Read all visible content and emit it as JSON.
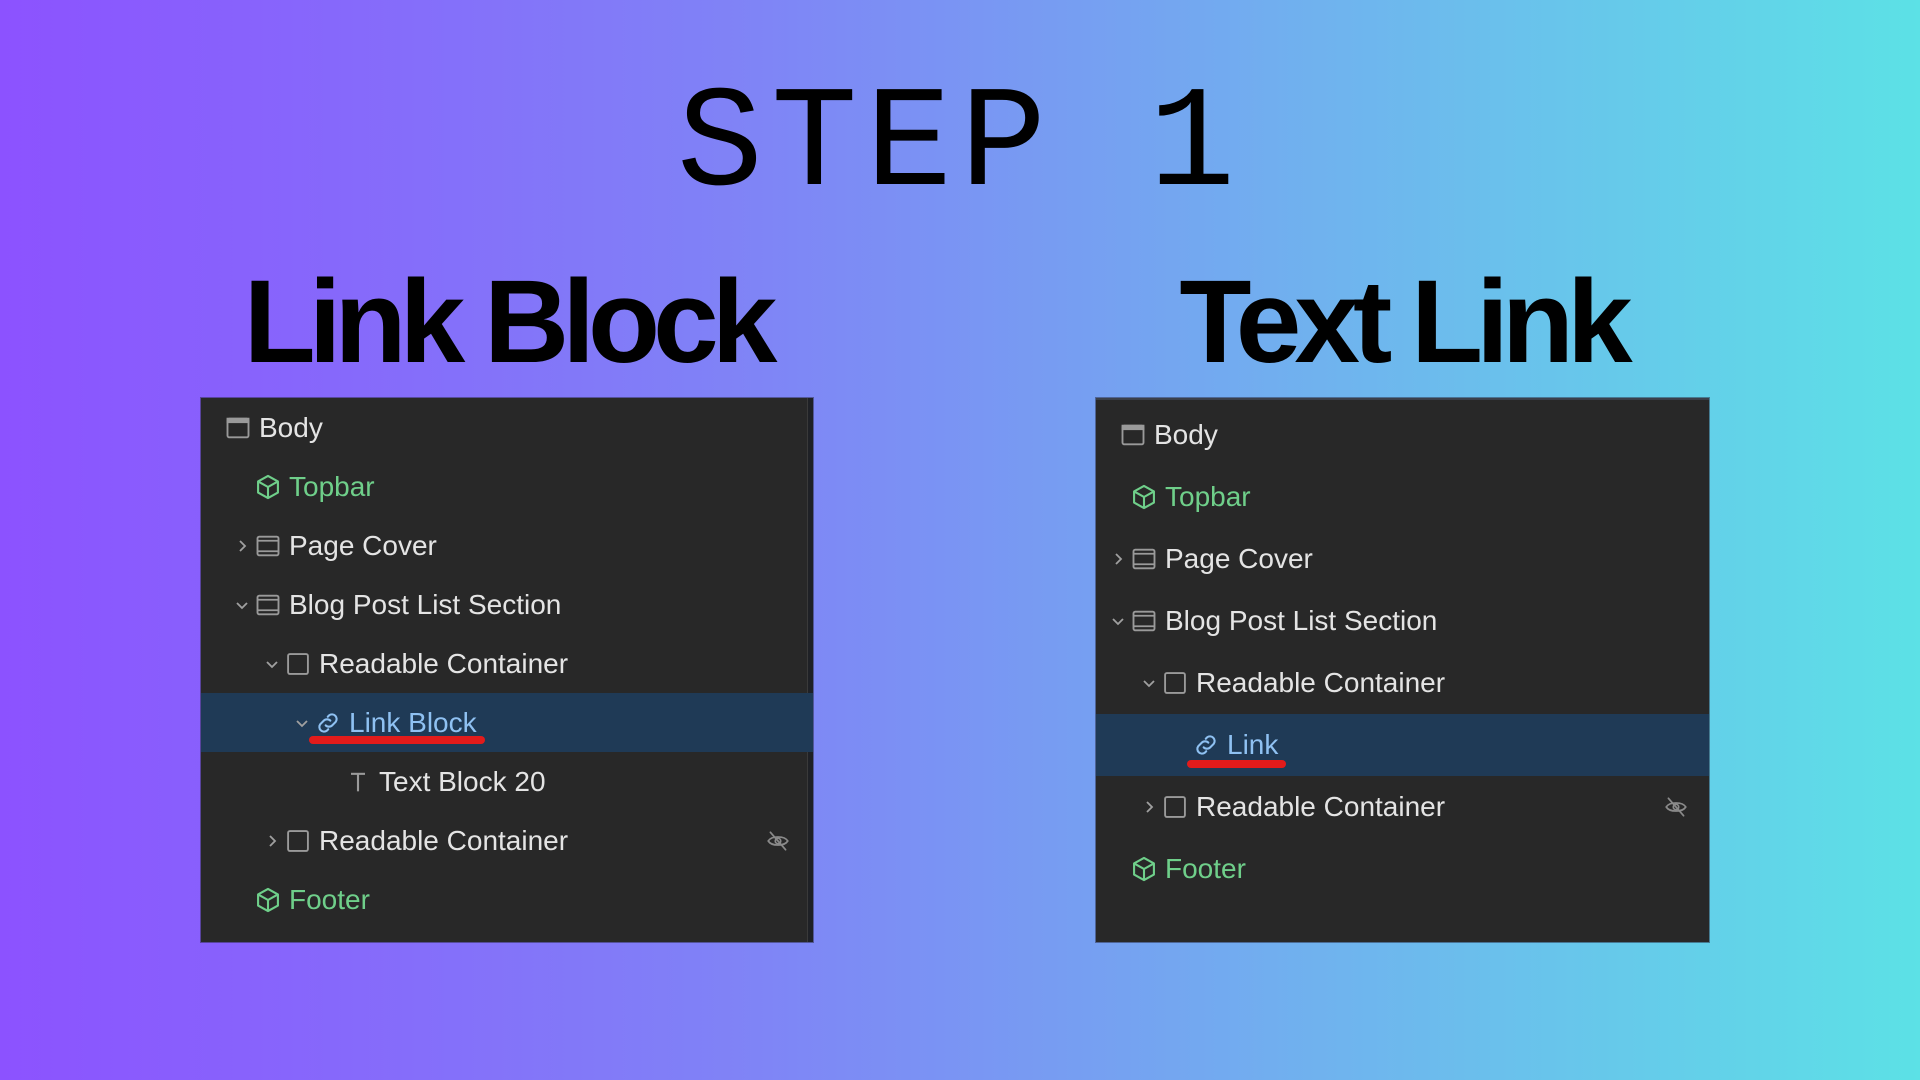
{
  "title": "STEP 1",
  "columns": {
    "left": {
      "heading": "Link Block"
    },
    "right": {
      "heading": "Text Link"
    }
  },
  "colors": {
    "gradient_start": "#8c52ff",
    "gradient_end": "#5ce1e6",
    "panel_bg": "#282828",
    "selected_row": "#1f3a56",
    "component_text": "#6fcf8a",
    "selected_text": "#8fc1f2",
    "underline": "#e21b1b"
  },
  "left_tree": [
    {
      "label": "Body",
      "icon": "body-icon",
      "level": 0,
      "chevron": "none"
    },
    {
      "label": "Topbar",
      "icon": "component-icon",
      "level": 1,
      "chevron": "none",
      "component": true
    },
    {
      "label": "Page Cover",
      "icon": "section-icon",
      "level": 1,
      "chevron": "right"
    },
    {
      "label": "Blog Post List Section",
      "icon": "section-icon",
      "level": 1,
      "chevron": "down"
    },
    {
      "label": "Readable Container",
      "icon": "div-icon",
      "level": 2,
      "chevron": "down"
    },
    {
      "label": "Link Block",
      "icon": "link-icon",
      "level": 3,
      "chevron": "down",
      "selected": true
    },
    {
      "label": "Text Block 20",
      "icon": "text-icon",
      "level": 4,
      "chevron": "none"
    },
    {
      "label": "Readable Container",
      "icon": "div-icon",
      "level": 2,
      "chevron": "right",
      "hidden": true
    },
    {
      "label": "Footer",
      "icon": "component-icon",
      "level": 1,
      "chevron": "none",
      "component": true
    }
  ],
  "right_tree": [
    {
      "label": "Body",
      "icon": "body-icon",
      "level": 0,
      "chevron": "none"
    },
    {
      "label": "Topbar",
      "icon": "component-icon",
      "level": 1,
      "chevron": "none",
      "component": true
    },
    {
      "label": "Page Cover",
      "icon": "section-icon",
      "level": 1,
      "chevron": "right"
    },
    {
      "label": "Blog Post List Section",
      "icon": "section-icon",
      "level": 1,
      "chevron": "down"
    },
    {
      "label": "Readable Container",
      "icon": "div-icon",
      "level": 2,
      "chevron": "down"
    },
    {
      "label": "Link",
      "icon": "link-icon",
      "level": 3,
      "chevron": "none",
      "selected": true
    },
    {
      "label": "Readable Container",
      "icon": "div-icon",
      "level": 2,
      "chevron": "right",
      "hidden": true
    },
    {
      "label": "Footer",
      "icon": "component-icon",
      "level": 1,
      "chevron": "none",
      "component": true
    }
  ]
}
